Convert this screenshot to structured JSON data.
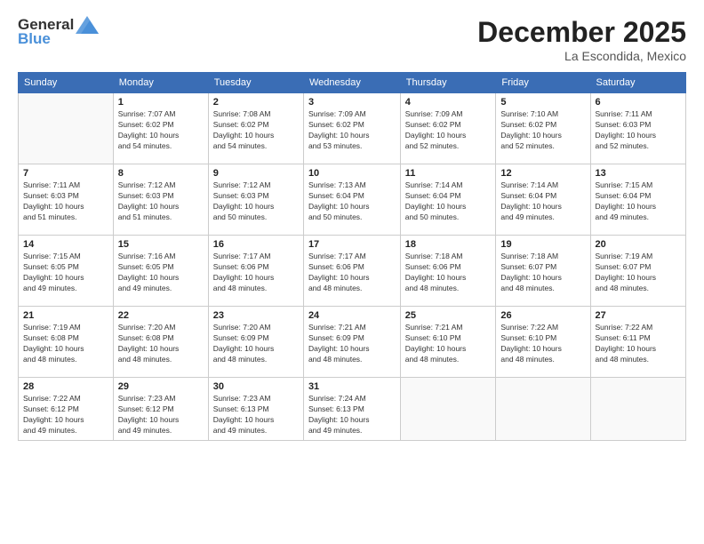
{
  "header": {
    "logo": {
      "general": "General",
      "blue": "Blue"
    },
    "title": "December 2025",
    "location": "La Escondida, Mexico"
  },
  "calendar": {
    "days_of_week": [
      "Sunday",
      "Monday",
      "Tuesday",
      "Wednesday",
      "Thursday",
      "Friday",
      "Saturday"
    ],
    "weeks": [
      [
        {
          "day": "",
          "info": ""
        },
        {
          "day": "1",
          "info": "Sunrise: 7:07 AM\nSunset: 6:02 PM\nDaylight: 10 hours\nand 54 minutes."
        },
        {
          "day": "2",
          "info": "Sunrise: 7:08 AM\nSunset: 6:02 PM\nDaylight: 10 hours\nand 54 minutes."
        },
        {
          "day": "3",
          "info": "Sunrise: 7:09 AM\nSunset: 6:02 PM\nDaylight: 10 hours\nand 53 minutes."
        },
        {
          "day": "4",
          "info": "Sunrise: 7:09 AM\nSunset: 6:02 PM\nDaylight: 10 hours\nand 52 minutes."
        },
        {
          "day": "5",
          "info": "Sunrise: 7:10 AM\nSunset: 6:02 PM\nDaylight: 10 hours\nand 52 minutes."
        },
        {
          "day": "6",
          "info": "Sunrise: 7:11 AM\nSunset: 6:03 PM\nDaylight: 10 hours\nand 52 minutes."
        }
      ],
      [
        {
          "day": "7",
          "info": "Sunrise: 7:11 AM\nSunset: 6:03 PM\nDaylight: 10 hours\nand 51 minutes."
        },
        {
          "day": "8",
          "info": "Sunrise: 7:12 AM\nSunset: 6:03 PM\nDaylight: 10 hours\nand 51 minutes."
        },
        {
          "day": "9",
          "info": "Sunrise: 7:12 AM\nSunset: 6:03 PM\nDaylight: 10 hours\nand 50 minutes."
        },
        {
          "day": "10",
          "info": "Sunrise: 7:13 AM\nSunset: 6:04 PM\nDaylight: 10 hours\nand 50 minutes."
        },
        {
          "day": "11",
          "info": "Sunrise: 7:14 AM\nSunset: 6:04 PM\nDaylight: 10 hours\nand 50 minutes."
        },
        {
          "day": "12",
          "info": "Sunrise: 7:14 AM\nSunset: 6:04 PM\nDaylight: 10 hours\nand 49 minutes."
        },
        {
          "day": "13",
          "info": "Sunrise: 7:15 AM\nSunset: 6:04 PM\nDaylight: 10 hours\nand 49 minutes."
        }
      ],
      [
        {
          "day": "14",
          "info": "Sunrise: 7:15 AM\nSunset: 6:05 PM\nDaylight: 10 hours\nand 49 minutes."
        },
        {
          "day": "15",
          "info": "Sunrise: 7:16 AM\nSunset: 6:05 PM\nDaylight: 10 hours\nand 49 minutes."
        },
        {
          "day": "16",
          "info": "Sunrise: 7:17 AM\nSunset: 6:06 PM\nDaylight: 10 hours\nand 48 minutes."
        },
        {
          "day": "17",
          "info": "Sunrise: 7:17 AM\nSunset: 6:06 PM\nDaylight: 10 hours\nand 48 minutes."
        },
        {
          "day": "18",
          "info": "Sunrise: 7:18 AM\nSunset: 6:06 PM\nDaylight: 10 hours\nand 48 minutes."
        },
        {
          "day": "19",
          "info": "Sunrise: 7:18 AM\nSunset: 6:07 PM\nDaylight: 10 hours\nand 48 minutes."
        },
        {
          "day": "20",
          "info": "Sunrise: 7:19 AM\nSunset: 6:07 PM\nDaylight: 10 hours\nand 48 minutes."
        }
      ],
      [
        {
          "day": "21",
          "info": "Sunrise: 7:19 AM\nSunset: 6:08 PM\nDaylight: 10 hours\nand 48 minutes."
        },
        {
          "day": "22",
          "info": "Sunrise: 7:20 AM\nSunset: 6:08 PM\nDaylight: 10 hours\nand 48 minutes."
        },
        {
          "day": "23",
          "info": "Sunrise: 7:20 AM\nSunset: 6:09 PM\nDaylight: 10 hours\nand 48 minutes."
        },
        {
          "day": "24",
          "info": "Sunrise: 7:21 AM\nSunset: 6:09 PM\nDaylight: 10 hours\nand 48 minutes."
        },
        {
          "day": "25",
          "info": "Sunrise: 7:21 AM\nSunset: 6:10 PM\nDaylight: 10 hours\nand 48 minutes."
        },
        {
          "day": "26",
          "info": "Sunrise: 7:22 AM\nSunset: 6:10 PM\nDaylight: 10 hours\nand 48 minutes."
        },
        {
          "day": "27",
          "info": "Sunrise: 7:22 AM\nSunset: 6:11 PM\nDaylight: 10 hours\nand 48 minutes."
        }
      ],
      [
        {
          "day": "28",
          "info": "Sunrise: 7:22 AM\nSunset: 6:12 PM\nDaylight: 10 hours\nand 49 minutes."
        },
        {
          "day": "29",
          "info": "Sunrise: 7:23 AM\nSunset: 6:12 PM\nDaylight: 10 hours\nand 49 minutes."
        },
        {
          "day": "30",
          "info": "Sunrise: 7:23 AM\nSunset: 6:13 PM\nDaylight: 10 hours\nand 49 minutes."
        },
        {
          "day": "31",
          "info": "Sunrise: 7:24 AM\nSunset: 6:13 PM\nDaylight: 10 hours\nand 49 minutes."
        },
        {
          "day": "",
          "info": ""
        },
        {
          "day": "",
          "info": ""
        },
        {
          "day": "",
          "info": ""
        }
      ]
    ]
  }
}
